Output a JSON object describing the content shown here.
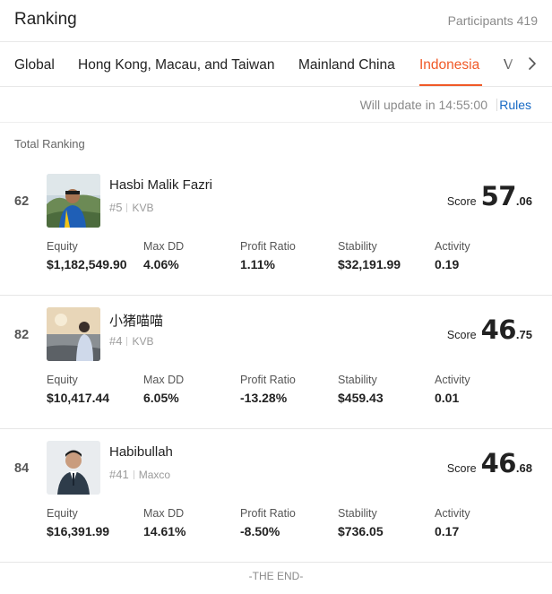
{
  "header": {
    "title": "Ranking",
    "participants": "Participants 419"
  },
  "tabs": [
    {
      "label": "Global",
      "active": false
    },
    {
      "label": "Hong Kong, Macau, and Taiwan",
      "active": false
    },
    {
      "label": "Mainland China",
      "active": false
    },
    {
      "label": "Indonesia",
      "active": true
    },
    {
      "label": "V",
      "active": false
    }
  ],
  "update_text": "Will update in 14:55:00",
  "rules_label": "Rules",
  "section_label": "Total Ranking",
  "stat_labels": {
    "equity": "Equity",
    "max_dd": "Max DD",
    "profit_ratio": "Profit Ratio",
    "stability": "Stability",
    "activity": "Activity"
  },
  "score_label": "Score",
  "rows": [
    {
      "rank": "62",
      "name": "Hasbi Malik Fazri",
      "position": "#5",
      "broker": "KVB",
      "score_int": "57",
      "score_dec": ".06",
      "equity": "$1,182,549.90",
      "max_dd": "4.06%",
      "profit_ratio": "1.11%",
      "stability": "$32,191.99",
      "activity": "0.19"
    },
    {
      "rank": "82",
      "name": "小猪喵喵",
      "position": "#4",
      "broker": "KVB",
      "score_int": "46",
      "score_dec": ".75",
      "equity": "$10,417.44",
      "max_dd": "6.05%",
      "profit_ratio": "-13.28%",
      "stability": "$459.43",
      "activity": "0.01"
    },
    {
      "rank": "84",
      "name": "Habibullah",
      "position": "#41",
      "broker": "Maxco",
      "score_int": "46",
      "score_dec": ".68",
      "equity": "$16,391.99",
      "max_dd": "14.61%",
      "profit_ratio": "-8.50%",
      "stability": "$736.05",
      "activity": "0.17"
    }
  ],
  "end_text": "-THE END-",
  "colors": {
    "accent": "#f05a28",
    "link": "#1769c4",
    "muted": "#8a8a8a"
  }
}
